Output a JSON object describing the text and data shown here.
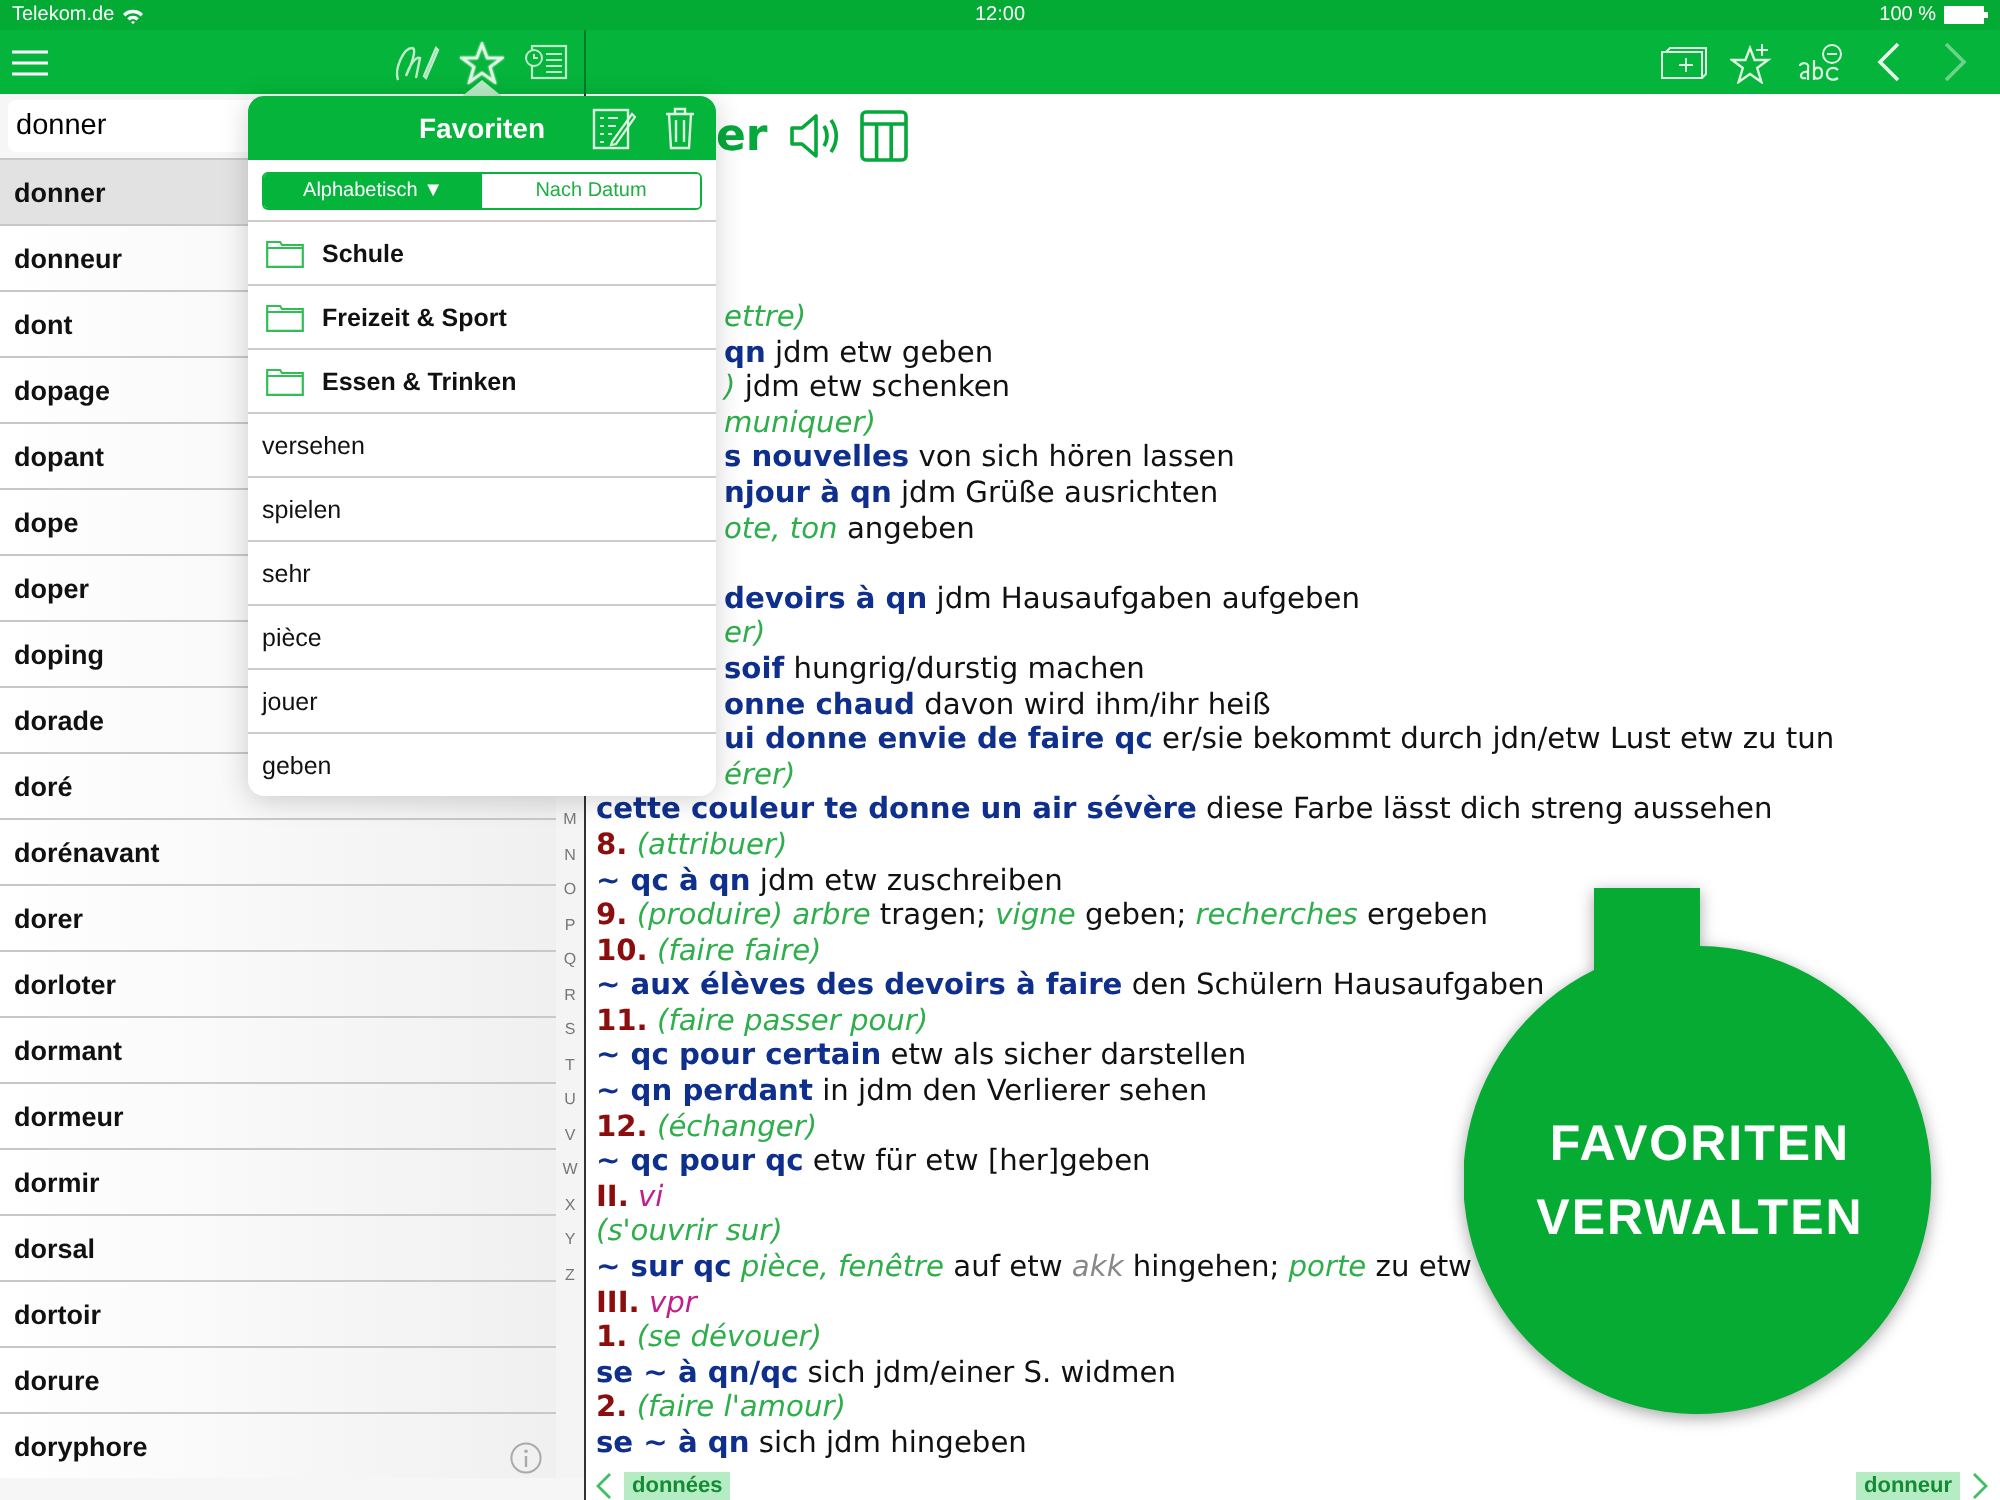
{
  "status_bar": {
    "carrier": "Telekom.de",
    "time": "12:00",
    "battery": "100 %"
  },
  "toolbar": {
    "left_tools": [
      {
        "kind": "handwriting",
        "selected": false
      },
      {
        "kind": "star",
        "selected": true
      },
      {
        "kind": "history",
        "selected": false
      }
    ],
    "right_tools": [
      {
        "kind": "add-card",
        "disabled": false
      },
      {
        "kind": "star-plus",
        "disabled": false
      },
      {
        "kind": "abc-minus",
        "disabled": false
      },
      {
        "kind": "back",
        "disabled": false
      },
      {
        "kind": "forward",
        "disabled": true
      }
    ]
  },
  "search": {
    "value": "donner"
  },
  "word_list": [
    {
      "word": "donner",
      "selected": true
    },
    {
      "word": "donneur",
      "selected": false
    },
    {
      "word": "dont",
      "selected": false
    },
    {
      "word": "dopage",
      "selected": false
    },
    {
      "word": "dopant",
      "selected": false
    },
    {
      "word": "dope",
      "selected": false
    },
    {
      "word": "doper",
      "selected": false
    },
    {
      "word": "doping",
      "selected": false
    },
    {
      "word": "dorade",
      "selected": false
    },
    {
      "word": "doré",
      "selected": false
    },
    {
      "word": "dorénavant",
      "selected": false
    },
    {
      "word": "dorer",
      "selected": false
    },
    {
      "word": "dorloter",
      "selected": false
    },
    {
      "word": "dormant",
      "selected": false
    },
    {
      "word": "dormeur",
      "selected": false
    },
    {
      "word": "dormir",
      "selected": false
    },
    {
      "word": "dorsal",
      "selected": false
    },
    {
      "word": "dortoir",
      "selected": false
    },
    {
      "word": "dorure",
      "selected": false
    },
    {
      "word": "doryphore",
      "selected": false
    }
  ],
  "index_letters": [
    "M",
    "N",
    "O",
    "P",
    "Q",
    "R",
    "S",
    "T",
    "U",
    "V",
    "W",
    "X",
    "Y",
    "Z"
  ],
  "favorites_popover": {
    "title": "Favoriten",
    "sort_tabs": [
      {
        "label": "Alphabetisch ▼",
        "selected": true
      },
      {
        "label": "Nach Datum",
        "selected": false
      }
    ],
    "items": [
      {
        "kind": "folder",
        "label": "Schule"
      },
      {
        "kind": "folder",
        "label": "Freizeit & Sport"
      },
      {
        "kind": "folder",
        "label": "Essen & Trinken"
      },
      {
        "kind": "word",
        "label": "versehen"
      },
      {
        "kind": "word",
        "label": "spielen"
      },
      {
        "kind": "word",
        "label": "sehr"
      },
      {
        "kind": "word",
        "label": "pièce"
      },
      {
        "kind": "word",
        "label": "jouer"
      },
      {
        "kind": "word",
        "label": "geben"
      }
    ]
  },
  "entry": {
    "headword": "er",
    "lines": [
      {
        "covered": true,
        "parts": [
          {
            "kind": "gloss",
            "text": "ettre)"
          }
        ]
      },
      {
        "covered": true,
        "parts": [
          {
            "kind": "phrase",
            "text": "qn"
          },
          {
            "kind": "trans",
            "text": " jdm etw geben"
          }
        ]
      },
      {
        "covered": true,
        "parts": [
          {
            "kind": "gloss",
            "text": ")"
          },
          {
            "kind": "trans",
            "text": " jdm etw schenken"
          }
        ]
      },
      {
        "covered": true,
        "parts": [
          {
            "kind": "gloss",
            "text": "muniquer)"
          }
        ]
      },
      {
        "covered": true,
        "parts": [
          {
            "kind": "phrase",
            "text": "s nouvelles"
          },
          {
            "kind": "trans",
            "text": " von sich hören lassen"
          }
        ]
      },
      {
        "covered": true,
        "parts": [
          {
            "kind": "phrase",
            "text": "njour à qn"
          },
          {
            "kind": "trans",
            "text": " jdm Grüße ausrichten"
          }
        ]
      },
      {
        "covered": true,
        "parts": [
          {
            "kind": "gloss",
            "text": "ote, ton"
          },
          {
            "kind": "trans",
            "text": " angeben"
          }
        ]
      },
      {
        "covered": true,
        "gap_before": true,
        "parts": [
          {
            "kind": "phrase",
            "text": "devoirs à qn"
          },
          {
            "kind": "trans",
            "text": " jdm Hausaufgaben aufgeben"
          }
        ]
      },
      {
        "covered": true,
        "parts": [
          {
            "kind": "gloss",
            "text": "er)"
          }
        ]
      },
      {
        "covered": true,
        "parts": [
          {
            "kind": "phrase",
            "text": "soif"
          },
          {
            "kind": "trans",
            "text": " hungrig/durstig machen"
          }
        ]
      },
      {
        "covered": true,
        "parts": [
          {
            "kind": "phrase",
            "text": "onne chaud"
          },
          {
            "kind": "trans",
            "text": " davon wird ihm/ihr heiß"
          }
        ]
      },
      {
        "covered": true,
        "parts": [
          {
            "kind": "phrase",
            "text": "ui donne envie de faire qc"
          },
          {
            "kind": "trans",
            "text": " er/sie bekommt durch jdn/etw Lust etw zu tun"
          }
        ]
      },
      {
        "covered": true,
        "parts": [
          {
            "kind": "gloss",
            "text": "érer)"
          }
        ]
      },
      {
        "covered": false,
        "parts": [
          {
            "kind": "phrase",
            "text": "cette couleur te donne un air sévère"
          },
          {
            "kind": "trans",
            "text": " diese Farbe lässt dich streng aussehen"
          }
        ]
      },
      {
        "covered": false,
        "parts": [
          {
            "kind": "num",
            "text": "8."
          },
          {
            "kind": "gloss",
            "text": " (attribuer)"
          }
        ]
      },
      {
        "covered": false,
        "parts": [
          {
            "kind": "phrase",
            "text": "~ qc à qn"
          },
          {
            "kind": "trans",
            "text": " jdm etw zuschreiben"
          }
        ]
      },
      {
        "covered": false,
        "parts": [
          {
            "kind": "num",
            "text": "9."
          },
          {
            "kind": "gloss",
            "text": " (produire) arbre"
          },
          {
            "kind": "trans",
            "text": " tragen; "
          },
          {
            "kind": "gloss",
            "text": "vigne"
          },
          {
            "kind": "trans",
            "text": " geben; "
          },
          {
            "kind": "gloss",
            "text": "recherches"
          },
          {
            "kind": "trans",
            "text": " ergeben"
          }
        ]
      },
      {
        "covered": false,
        "parts": [
          {
            "kind": "num",
            "text": "10."
          },
          {
            "kind": "gloss",
            "text": " (faire faire)"
          }
        ]
      },
      {
        "covered": false,
        "parts": [
          {
            "kind": "phrase",
            "text": "~ aux élèves des devoirs à faire"
          },
          {
            "kind": "trans",
            "text": " den Schülern Hausaufgaben"
          }
        ]
      },
      {
        "covered": false,
        "parts": [
          {
            "kind": "num",
            "text": "11."
          },
          {
            "kind": "gloss",
            "text": " (faire passer pour)"
          }
        ]
      },
      {
        "covered": false,
        "parts": [
          {
            "kind": "phrase",
            "text": "~ qc pour certain"
          },
          {
            "kind": "trans",
            "text": " etw als sicher darstellen"
          }
        ]
      },
      {
        "covered": false,
        "parts": [
          {
            "kind": "phrase",
            "text": "~ qn perdant"
          },
          {
            "kind": "trans",
            "text": " in jdm den Verlierer sehen"
          }
        ]
      },
      {
        "covered": false,
        "parts": [
          {
            "kind": "num",
            "text": "12."
          },
          {
            "kind": "gloss",
            "text": " (échanger)"
          }
        ]
      },
      {
        "covered": false,
        "parts": [
          {
            "kind": "phrase",
            "text": "~ qc pour qc"
          },
          {
            "kind": "trans",
            "text": " etw für etw [her]geben"
          }
        ]
      },
      {
        "covered": false,
        "parts": [
          {
            "kind": "num",
            "text": "II."
          },
          {
            "kind": "gram",
            "text": " vi"
          }
        ]
      },
      {
        "covered": false,
        "parts": [
          {
            "kind": "gloss",
            "text": "(s'ouvrir sur)"
          }
        ]
      },
      {
        "covered": false,
        "parts": [
          {
            "kind": "phrase",
            "text": "~ sur qc"
          },
          {
            "kind": "gloss",
            "text": " pièce, fenêtre"
          },
          {
            "kind": "trans",
            "text": " auf etw "
          },
          {
            "kind": "label",
            "text": "akk"
          },
          {
            "kind": "trans",
            "text": " hingehen; "
          },
          {
            "kind": "gloss",
            "text": "porte"
          },
          {
            "kind": "trans",
            "text": " zu etw"
          }
        ]
      },
      {
        "covered": false,
        "parts": [
          {
            "kind": "num",
            "text": "III."
          },
          {
            "kind": "gram",
            "text": " vpr"
          }
        ]
      },
      {
        "covered": false,
        "parts": [
          {
            "kind": "num",
            "text": "1."
          },
          {
            "kind": "gloss",
            "text": " (se dévouer)"
          }
        ]
      },
      {
        "covered": false,
        "parts": [
          {
            "kind": "phrase",
            "text": "se ~ à qn/qc"
          },
          {
            "kind": "trans",
            "text": " sich jdm/einer S. widmen"
          }
        ]
      },
      {
        "covered": false,
        "parts": [
          {
            "kind": "num",
            "text": "2."
          },
          {
            "kind": "gloss",
            "text": " (faire l'amour)"
          }
        ]
      },
      {
        "covered": false,
        "parts": [
          {
            "kind": "phrase",
            "text": "se ~ à qn"
          },
          {
            "kind": "trans",
            "text": " sich jdm hingeben"
          }
        ]
      }
    ],
    "prev_word": "données",
    "next_word": "donneur"
  },
  "callout": {
    "text": "FAVORITEN VERWALTEN"
  }
}
